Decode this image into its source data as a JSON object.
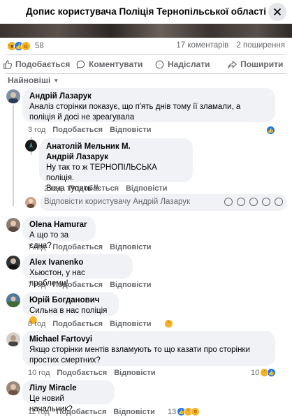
{
  "header": {
    "title": "Допис користувача Поліція Тернопільської області"
  },
  "stats": {
    "reaction_count": "58",
    "comments": "17 коментарів",
    "shares": "2 поширення"
  },
  "actions": {
    "like": "Подобається",
    "comment": "Коментувати",
    "send": "Надіслати",
    "share": "Поширити"
  },
  "sort": {
    "label": "Найновіші"
  },
  "labels": {
    "like": "Подобається",
    "reply": "Відповісти"
  },
  "comments": [
    {
      "author": "Андрій Лазарук",
      "lines": [
        "Аналіз сторінки показує, що п'ять днів тому її зламали, а",
        "поліція й досі не зреагувала"
      ],
      "time": "3 год"
    },
    {
      "author": "Анатолій Мельник М.",
      "lines": [
        "Андрій Лазарук",
        "Ну так то ж ТЕРНОПІЛЬСЬКА поліція.",
        "Вона тупить !!"
      ],
      "time": "2 год"
    },
    {
      "author": "Olena Hamurar",
      "lines": [
        "А що то за єдна?"
      ],
      "time": "7 год"
    },
    {
      "author": "Alex Ivanenko",
      "lines": [
        "Хьюстон, у нас проблеми!"
      ],
      "time": "7 год"
    },
    {
      "author": "Юрій Богданович",
      "lines": [
        "Сильна в нас поліція"
      ],
      "time": "8 год"
    },
    {
      "author": "Michael Fartovyi",
      "lines": [
        "Якщо сторінки ментів взламують то що казати про сторінки",
        "простих смертних?"
      ],
      "time": "10 год",
      "reaction_count": "10"
    },
    {
      "author": "Лілу Miracle",
      "lines": [
        "Це новий начальник?"
      ],
      "time": "11 год",
      "reaction_count": "13"
    }
  ],
  "reply_box": {
    "placeholder": "Відповісти користувачу Андрій Лазарук"
  }
}
